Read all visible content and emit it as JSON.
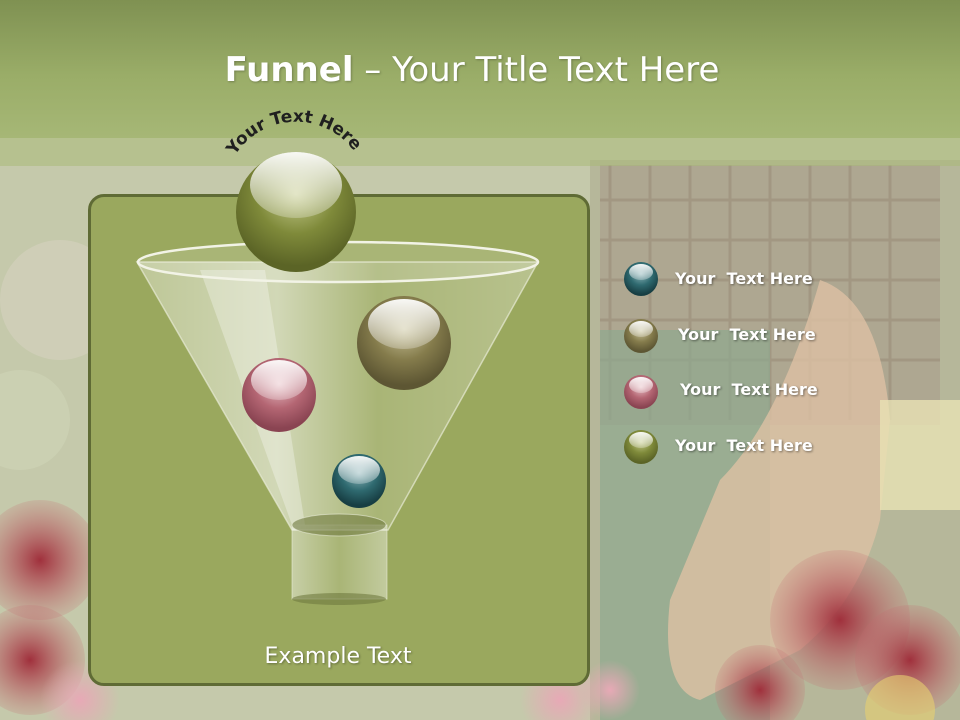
{
  "slide": {
    "title_bold": "Funnel",
    "title_rest": " – Your Title Text Here",
    "arc_text": "Your Text Here",
    "example_text": "Example Text"
  },
  "legend": {
    "items": [
      {
        "label": "Your  Text Here",
        "color": "#1f5d63"
      },
      {
        "label": "Your  Text Here",
        "color": "#7a7a3c"
      },
      {
        "label": "Your  Text Here",
        "color": "#b46673"
      },
      {
        "label": "Your  Text Here",
        "color": "#6f7d2e"
      }
    ]
  },
  "colors": {
    "title_band": "#9aad68",
    "panel": "#9aa85e",
    "panel_border": "#5f6b35"
  }
}
